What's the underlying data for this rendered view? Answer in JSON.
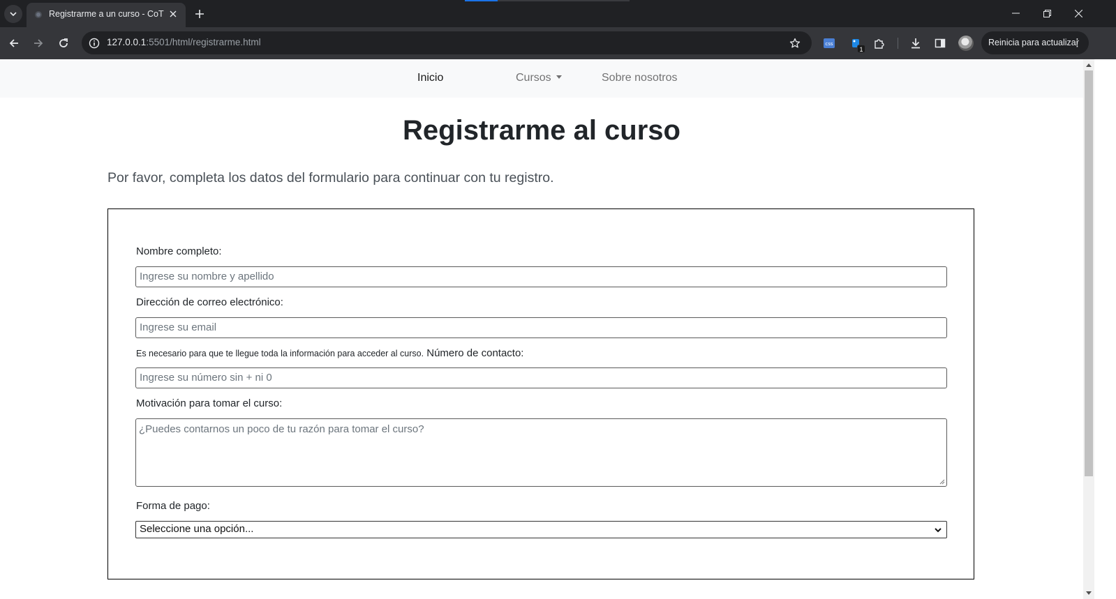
{
  "browser": {
    "tab_title": "Registrarme a un curso - CoT",
    "url_host": "127.0.0.1",
    "url_rest": ":5501/html/registrarme.html",
    "extension_badge": "1",
    "update_button": "Reinicia para actualizar",
    "icons": [
      "tab-search-icon",
      "close-icon",
      "plus-icon",
      "minimize-icon",
      "restore-icon",
      "close-window-icon",
      "back-arrow-icon",
      "forward-arrow-icon",
      "reload-icon",
      "site-info-icon",
      "star-icon",
      "extension-icon",
      "puzzle-icon",
      "download-icon",
      "side-panel-icon",
      "kebab-menu-icon"
    ]
  },
  "navbar": {
    "items": [
      {
        "label": "Inicio",
        "active": true
      },
      {
        "label": "Cursos",
        "dropdown": true
      },
      {
        "label": "Sobre nosotros"
      }
    ]
  },
  "page": {
    "title": "Registrarme al curso",
    "lead": "Por favor, completa los datos del formulario para continuar con tu registro."
  },
  "form": {
    "name_label": "Nombre completo:",
    "name_placeholder": "Ingrese su nombre y apellido",
    "email_label": "Dirección de correo electrónico:",
    "email_placeholder": "Ingrese su email",
    "email_help": "Es necesario para que te llegue toda la información para acceder al curso.",
    "phone_label": "Número de contacto:",
    "phone_placeholder": "Ingrese su número sin + ni 0",
    "motivation_label": "Motivación para tomar el curso:",
    "motivation_placeholder": "¿Puedes contarnos un poco de tu razón para tomar el curso?",
    "payment_label": "Forma de pago:",
    "payment_selected": "Seleccione una opción..."
  }
}
